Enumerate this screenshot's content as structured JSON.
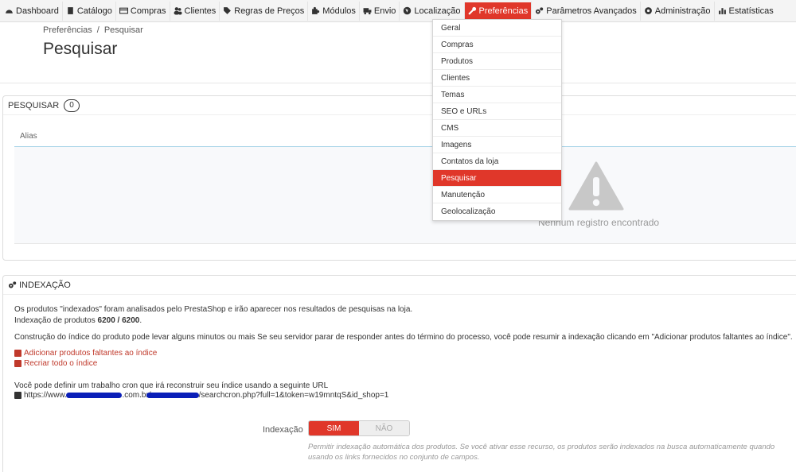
{
  "nav": {
    "items": [
      {
        "label": "Dashboard",
        "icon": "dashboard-icon"
      },
      {
        "label": "Catálogo",
        "icon": "book-icon"
      },
      {
        "label": "Compras",
        "icon": "credit-card-icon"
      },
      {
        "label": "Clientes",
        "icon": "users-icon"
      },
      {
        "label": "Regras de Preços",
        "icon": "tag-icon"
      },
      {
        "label": "Módulos",
        "icon": "puzzle-icon"
      },
      {
        "label": "Envio",
        "icon": "truck-icon"
      },
      {
        "label": "Localização",
        "icon": "globe-icon"
      },
      {
        "label": "Preferências",
        "icon": "wrench-icon",
        "active": true
      },
      {
        "label": "Parâmetros Avançados",
        "icon": "cogs-icon"
      },
      {
        "label": "Administração",
        "icon": "gear-icon"
      },
      {
        "label": "Estatísticas",
        "icon": "bar-chart-icon"
      }
    ]
  },
  "dropdown": {
    "items": [
      "Geral",
      "Compras",
      "Produtos",
      "Clientes",
      "Temas",
      "SEO e URLs",
      "CMS",
      "Imagens",
      "Contatos da loja",
      "Pesquisar",
      "Manutenção",
      "Geolocalização"
    ],
    "active": "Pesquisar"
  },
  "header": {
    "breadcrumb": [
      "Preferências",
      "/",
      "Pesquisar"
    ],
    "title": "Pesquisar"
  },
  "search_panel": {
    "heading": "PESQUISAR",
    "count": "0",
    "column": "Alias",
    "empty": "Nenhum registro encontrado"
  },
  "index_panel": {
    "heading": "INDEXAÇÃO",
    "p1": "Os produtos \"indexados\" foram analisados pelo PrestaShop e irão aparecer nos resultados de pesquisas na loja.",
    "p2_prefix": "Indexação de produtos ",
    "p2_value": "6200 / 6200",
    "p2_suffix": ".",
    "p3": "Construção do índice do produto pode levar alguns minutos ou mais Se seu servidor parar de responder antes do término do processo, você pode resumir a indexação clicando em \"Adicionar produtos faltantes ao índice\".",
    "link1": "Adicionar produtos faltantes ao índice",
    "link2": "Recriar todo o índice",
    "cron_text": "Você pode definir um trabalho cron que irá reconstruir seu índice usando a seguinte URL",
    "url_start": "https://www.a",
    "url_mid": ".com.br/",
    "url_end": "/searchcron.php?full=1&token=w19mntqS&id_shop=1",
    "field_label": "Indexação",
    "switch_on": "SIM",
    "switch_off": "NÃO",
    "help": "Permitir indexação automática dos produtos. Se você ativar esse recurso, os produtos serão indexados na busca automaticamente quando usando os links fornecidos no conjunto de campos."
  },
  "colors": {
    "accent": "#e0372a",
    "redaction": "#0a1fb8"
  }
}
